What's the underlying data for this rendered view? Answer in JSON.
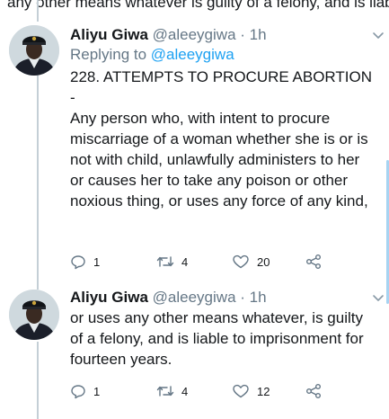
{
  "top_fragment": "any other means whatever is guilty of a felony, and is liable to",
  "tweets": [
    {
      "name": "Aliyu Giwa",
      "handle": "@aleeygiwa",
      "sep": " · ",
      "time": "1h",
      "replying_prefix": "Replying to ",
      "replying_to": "@aleeygiwa",
      "text": "228. ATTEMPTS TO PROCURE ABORTION\n-\nAny person who, with intent to procure miscarriage of a woman whether she is or is not with child, unlawfully administers to her or causes her to take any poison or other noxious thing, or uses any force of any kind,",
      "replies": "1",
      "retweets": "4",
      "likes": "20"
    },
    {
      "name": "Aliyu Giwa",
      "handle": "@aleeygiwa",
      "sep": " · ",
      "time": "1h",
      "text": "or uses any other means whatever, is guilty of a felony, and is liable to imprisonment for fourteen years.",
      "replies": "1",
      "retweets": "4",
      "likes": "12"
    }
  ],
  "colors": {
    "text": "#14171a",
    "secondary": "#657786",
    "link": "#1da1f2",
    "thread": "#c4cfd6"
  },
  "icons": [
    "reply-icon",
    "retweet-icon",
    "like-icon",
    "share-icon",
    "chevron-down-icon"
  ]
}
